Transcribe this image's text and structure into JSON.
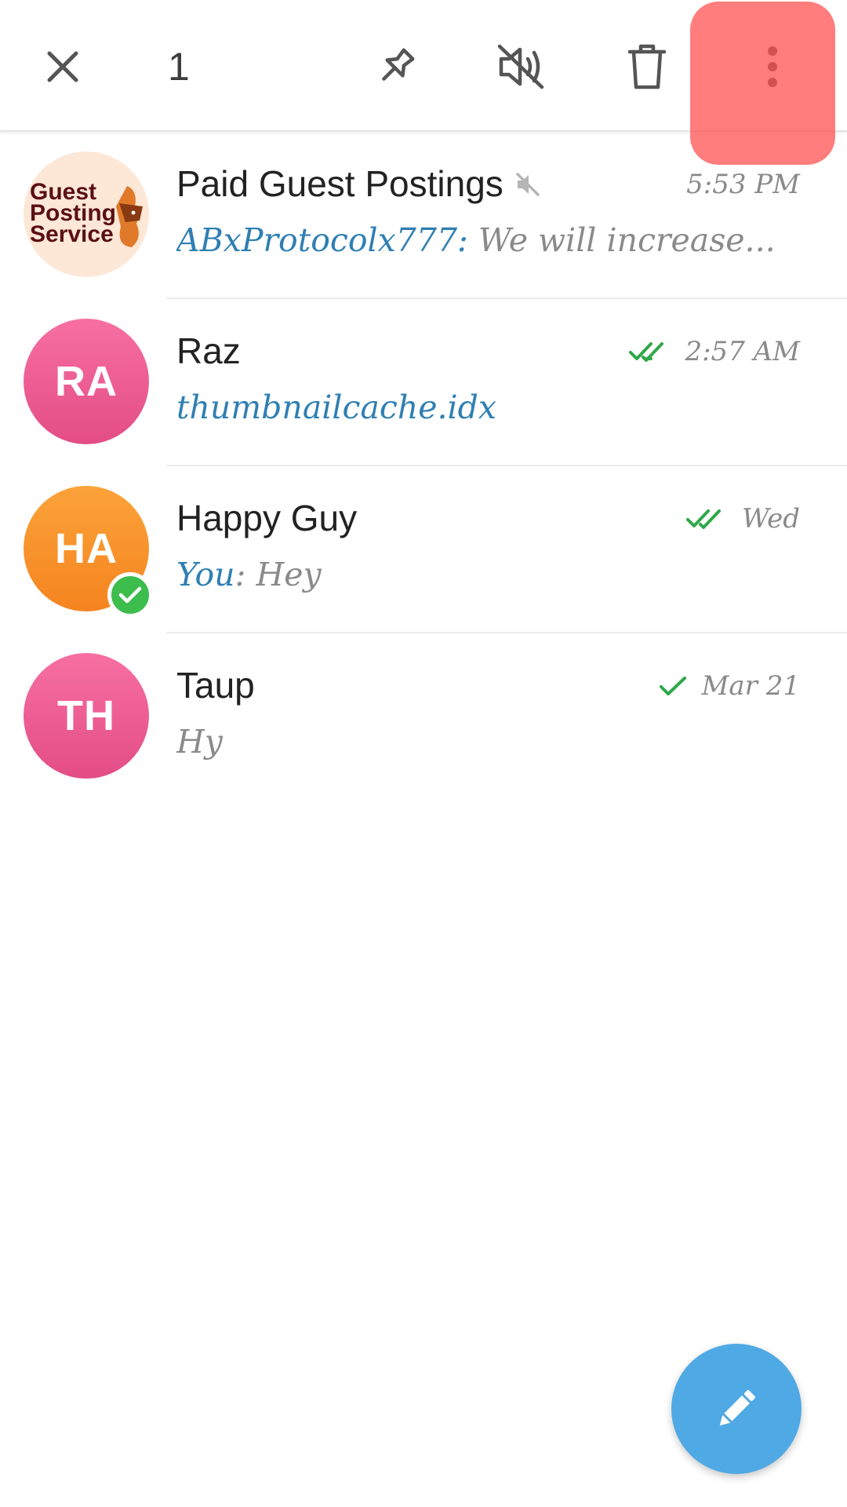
{
  "toolbar": {
    "selected_count": "1",
    "icons": [
      "close-icon",
      "pin-icon",
      "mute-icon",
      "delete-icon",
      "more-vertical-icon"
    ]
  },
  "chats": [
    {
      "name": "Paid Guest Postings",
      "avatar_logo_text": [
        "Guest",
        "Posting",
        "Service"
      ],
      "muted": true,
      "time": "5:53 PM",
      "sender": "ABxProtocolx777",
      "message": "We will increase..."
    },
    {
      "name": "Raz",
      "avatar_initials": "RA",
      "read_status": "double-check",
      "time": "2:57 AM",
      "message": "thumbnailcache.idx"
    },
    {
      "name": "Happy Guy",
      "avatar_initials": "HA",
      "verified": true,
      "read_status": "double-check",
      "time": "Wed",
      "sender": "You",
      "message": "Hey"
    },
    {
      "name": "Taup",
      "avatar_initials": "TH",
      "read_status": "single-check",
      "time": "Mar 21",
      "message": "Hy"
    }
  ],
  "colors": {
    "accent": "#4fa9e4",
    "link": "#2f7fb3",
    "check_green": "#3dbd4c",
    "highlight": "#ff5050"
  },
  "fab": {
    "icon": "pencil-icon"
  }
}
